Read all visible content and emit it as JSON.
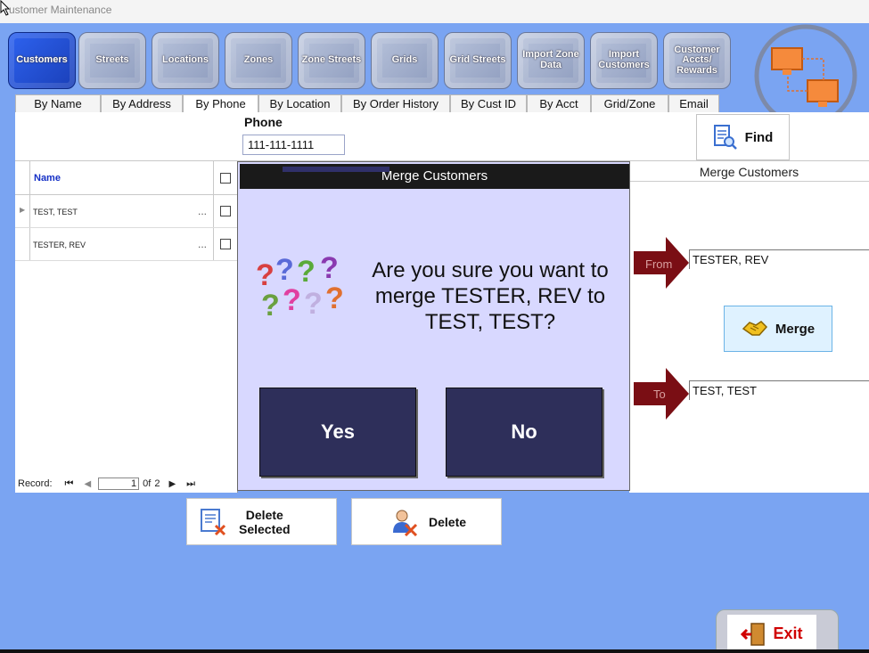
{
  "window": {
    "title": "ustomer Maintenance"
  },
  "modules": [
    {
      "label": "Customers",
      "active": true
    },
    {
      "label": "Streets"
    },
    {
      "label": "Locations"
    },
    {
      "label": "Zones"
    },
    {
      "label": "Zone Streets"
    },
    {
      "label": "Grids"
    },
    {
      "label": "Grid Streets"
    },
    {
      "label": "Import Zone Data"
    },
    {
      "label": "Import Customers"
    },
    {
      "label": "Customer Accts/ Rewards"
    }
  ],
  "search_tabs": [
    {
      "label": "By Name"
    },
    {
      "label": "By Address"
    },
    {
      "label": "By Phone",
      "active": true
    },
    {
      "label": "By Location"
    },
    {
      "label": "By Order History"
    },
    {
      "label": "By Cust ID"
    },
    {
      "label": "By Acct"
    },
    {
      "label": "Grid/Zone"
    },
    {
      "label": "Email"
    }
  ],
  "search": {
    "phone_label": "Phone",
    "phone_value": "111-111-1111",
    "find_label": "Find"
  },
  "grid": {
    "column_name": "Name",
    "rows": [
      {
        "name": "TEST, TEST",
        "dots": "..."
      },
      {
        "name": "TESTER, REV",
        "dots": "..."
      }
    ],
    "record_label": "Record:",
    "record_current": "1",
    "record_of": "0f",
    "record_total": "2"
  },
  "merge_panel": {
    "title": "Merge Customers",
    "from_label": "From",
    "from_value": "TESTER, REV",
    "to_label": "To",
    "to_value": "TEST, TEST",
    "merge_label": "Merge"
  },
  "dialog": {
    "title": "Merge Customers",
    "message": "Are you sure you want to merge TESTER, REV to TEST, TEST?",
    "yes_label": "Yes",
    "no_label": "No"
  },
  "bottom": {
    "delete_selected_line1": "Delete",
    "delete_selected_line2": "Selected",
    "delete_label": "Delete",
    "exit_label": "Exit"
  },
  "colors": {
    "background": "#7aa4f2",
    "active_tab": "#2e63f0",
    "dialog_button": "#2e2f5a",
    "arrow_maroon": "#7a0e14",
    "merge_button": "#dff2ff",
    "exit_text": "#d00000"
  }
}
